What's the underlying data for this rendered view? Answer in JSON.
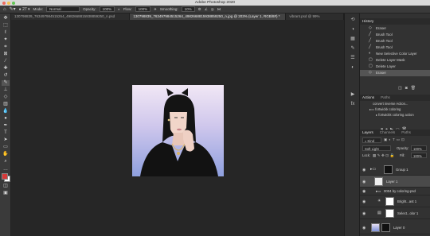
{
  "app": {
    "title": "Adobe Photoshop 2020"
  },
  "options": {
    "mode_label": "Mode:",
    "mode_value": "Normal",
    "opacity_label": "Opacity:",
    "opacity_value": "100%",
    "flow_label": "Flow:",
    "flow_value": "100%",
    "smoothing_label": "Smoothing:",
    "smoothing_value": "10%"
  },
  "tabs": [
    {
      "label": "130798839_763497984515264_4982668815938859250_n.psd"
    },
    {
      "label": "130798839_763497984515264_4982668815938859250_n.jpg @ 203% (Layer 1, RGB/8#) *"
    },
    {
      "label": "vibrant.psd @ 99%"
    }
  ],
  "history": {
    "title": "History",
    "items": [
      {
        "label": "Eraser",
        "icon": "eraser-icon"
      },
      {
        "label": "Brush Tool",
        "icon": "brush-icon"
      },
      {
        "label": "Brush Tool",
        "icon": "brush-icon"
      },
      {
        "label": "Brush Tool",
        "icon": "brush-icon"
      },
      {
        "label": "New Selective Color Layer",
        "icon": "adjustment-icon"
      },
      {
        "label": "Delete Layer Mask",
        "icon": "layer-icon"
      },
      {
        "label": "Delete Layer",
        "icon": "layer-icon"
      },
      {
        "label": "Eraser",
        "icon": "eraser-icon"
      }
    ]
  },
  "actions": {
    "title": "Actions",
    "tab2": "Paths",
    "items": [
      {
        "label": "convert inverse Action..."
      },
      {
        "label": "fortwickk coloring"
      },
      {
        "label": "fortwickk coloring action"
      }
    ]
  },
  "layers": {
    "tabs": [
      "Layers",
      "Channels",
      "Paths"
    ],
    "filter_value": "Kind",
    "blend_value": "Soft Light",
    "opacity_label": "Opacity:",
    "opacity_value": "100%",
    "lock_label": "Lock:",
    "fill_label": "Fill:",
    "fill_value": "100%",
    "rows": [
      {
        "name": "Group 1"
      },
      {
        "name": "Layer 1"
      },
      {
        "name": "0004 by coloring-psd"
      },
      {
        "name": "Bright...ast 1"
      },
      {
        "name": "Select...olor 1"
      },
      {
        "name": "Layer 0"
      }
    ]
  },
  "colors": {
    "foreground": "#d63a3a",
    "background": "#ffffff",
    "selection": "#545454"
  }
}
